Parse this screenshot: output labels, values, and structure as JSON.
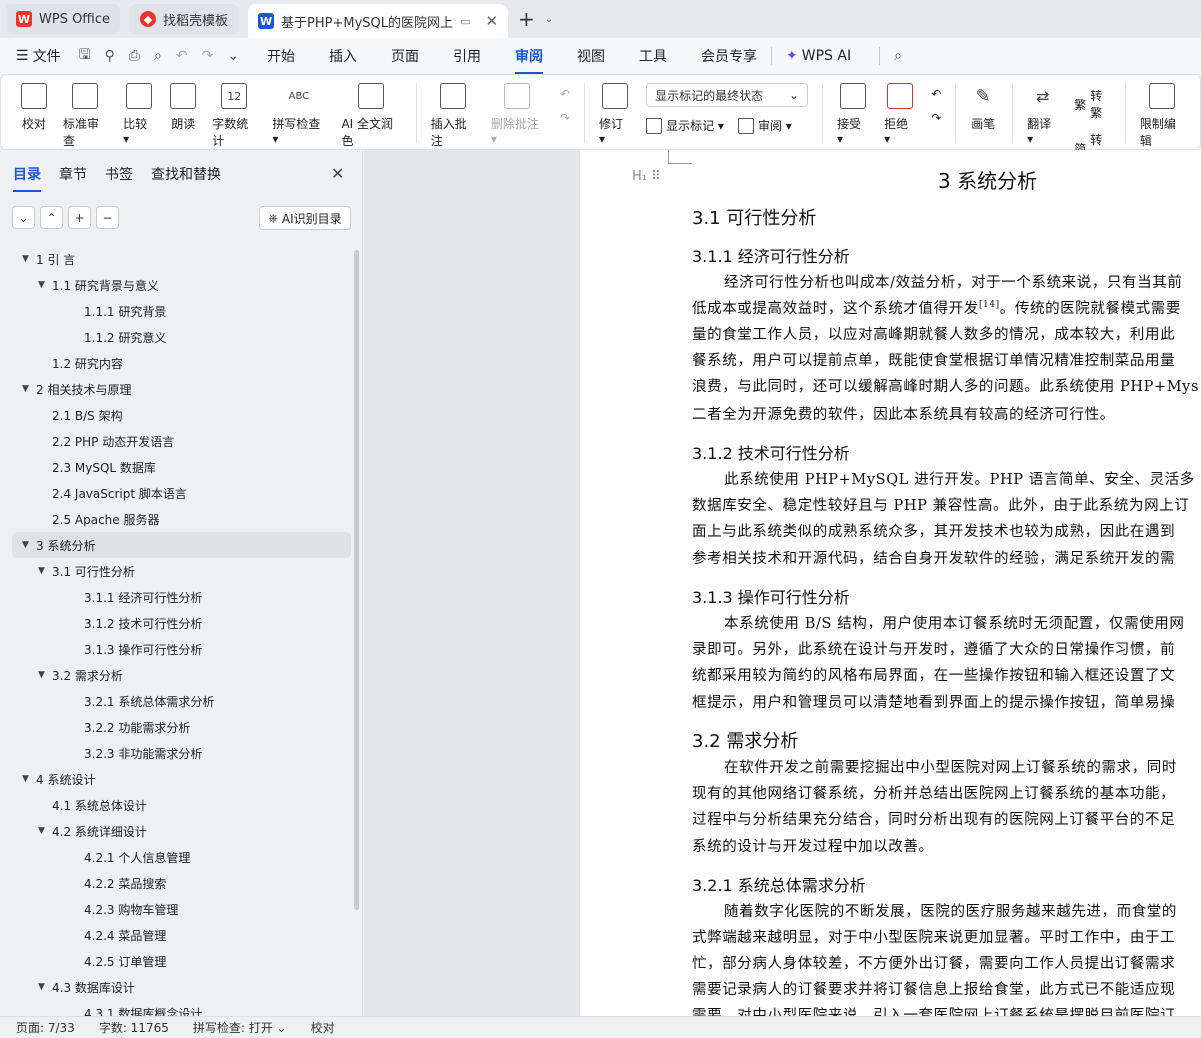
{
  "tabs": [
    {
      "label": "WPS Office",
      "icon": "wps-logo",
      "color": "#e8352e"
    },
    {
      "label": "找稻壳模板",
      "icon": "docer-logo",
      "color": "#e8352e"
    },
    {
      "label": "基于PHP+MySQL的医院网上",
      "icon": "word-doc-logo",
      "color": "#1a56db"
    }
  ],
  "menubar": {
    "file": "文件",
    "tabs": [
      "开始",
      "插入",
      "页面",
      "引用",
      "审阅",
      "视图",
      "工具",
      "会员专享"
    ],
    "active": "审阅",
    "ai": "WPS AI"
  },
  "ribbon": {
    "group1": [
      {
        "label": "校对",
        "icon": "proofread-icon"
      },
      {
        "label": "标准审查",
        "icon": "standard-review-icon"
      },
      {
        "label": "比较 ▾",
        "icon": "compare-icon"
      },
      {
        "label": "朗读",
        "icon": "read-aloud-icon"
      },
      {
        "label": "字数统计",
        "icon": "word-count-icon",
        "glyph": "12"
      },
      {
        "label": "拼写检查 ▾",
        "icon": "spell-check-icon",
        "glyph": "ABC"
      },
      {
        "label": "AI 全文润色",
        "icon": "ai-polish-icon"
      }
    ],
    "insert_comment": "插入批注",
    "delete_comment": "删除批注 ▾",
    "revise": "修订 ▾",
    "markup_dropdown": "显示标记的最终状态",
    "show_markup": "显示标记 ▾",
    "review": "审阅 ▾",
    "accept": "接受 ▾",
    "reject": "拒绝 ▾",
    "brush": "画笔",
    "translate": "翻译 ▾",
    "to_trad": "转繁",
    "to_simp": "转简",
    "restrict": "限制编辑"
  },
  "nav": {
    "tabs": [
      "目录",
      "章节",
      "书签",
      "查找和替换"
    ],
    "active": "目录",
    "ai_btn": "AI识别目录",
    "toc": [
      {
        "label": "1  引  言",
        "level": 1,
        "arrow": "▼"
      },
      {
        "label": "1.1  研究背景与意义",
        "level": 2,
        "arrow": "▼"
      },
      {
        "label": "1.1.1  研究背景",
        "level": 3,
        "arrow": ""
      },
      {
        "label": "1.1.2  研究意义",
        "level": 3,
        "arrow": ""
      },
      {
        "label": "1.2  研究内容",
        "level": 2,
        "arrow": ""
      },
      {
        "label": "2  相关技术与原理",
        "level": 1,
        "arrow": "▼"
      },
      {
        "label": "2.1 B/S 架构",
        "level": 2,
        "arrow": ""
      },
      {
        "label": "2.2 PHP 动态开发语言",
        "level": 2,
        "arrow": ""
      },
      {
        "label": "2.3 MySQL 数据库",
        "level": 2,
        "arrow": ""
      },
      {
        "label": "2.4 JavaScript 脚本语言",
        "level": 2,
        "arrow": ""
      },
      {
        "label": "2.5 Apache 服务器",
        "level": 2,
        "arrow": ""
      },
      {
        "label": "3  系统分析",
        "level": 1,
        "arrow": "▼",
        "selected": true
      },
      {
        "label": "3.1  可行性分析",
        "level": 2,
        "arrow": "▼"
      },
      {
        "label": "3.1.1  经济可行性分析",
        "level": 3,
        "arrow": ""
      },
      {
        "label": "3.1.2  技术可行性分析",
        "level": 3,
        "arrow": ""
      },
      {
        "label": "3.1.3  操作可行性分析",
        "level": 3,
        "arrow": ""
      },
      {
        "label": "3.2  需求分析",
        "level": 2,
        "arrow": "▼"
      },
      {
        "label": "3.2.1  系统总体需求分析",
        "level": 3,
        "arrow": ""
      },
      {
        "label": "3.2.2  功能需求分析",
        "level": 3,
        "arrow": ""
      },
      {
        "label": "3.2.3  非功能需求分析",
        "level": 3,
        "arrow": ""
      },
      {
        "label": "4  系统设计",
        "level": 1,
        "arrow": "▼"
      },
      {
        "label": "4.1  系统总体设计",
        "level": 2,
        "arrow": ""
      },
      {
        "label": "4.2  系统详细设计",
        "level": 2,
        "arrow": "▼"
      },
      {
        "label": "4.2.1  个人信息管理",
        "level": 3,
        "arrow": ""
      },
      {
        "label": "4.2.2  菜品搜索",
        "level": 3,
        "arrow": ""
      },
      {
        "label": "4.2.3  购物车管理",
        "level": 3,
        "arrow": ""
      },
      {
        "label": "4.2.4  菜品管理",
        "level": 3,
        "arrow": ""
      },
      {
        "label": "4.2.5  订单管理",
        "level": 3,
        "arrow": ""
      },
      {
        "label": "4.3  数据库设计",
        "level": 2,
        "arrow": "▼"
      },
      {
        "label": "4.3.1  数据库概念设计",
        "level": 3,
        "arrow": ""
      }
    ]
  },
  "doc": {
    "h1": "3  系统分析",
    "s31": "3.1  可行性分析",
    "s311": "3.1.1  经济可行性分析",
    "p311": [
      "经济可行性分析也叫成本/效益分析，对于一个系统来说，只有当其前",
      "低成本或提高效益时，这个系统才值得开发",
      "量的食堂工作人员，以应对高峰期就餐人数多的情况，成本较大，利用此",
      "餐系统，用户可以提前点单，既能使食堂根据订单情况精准控制菜品用量",
      "浪费，与此同时，还可以缓解高峰时期人多的问题。此系统使用 PHP+Mys",
      "二者全为开源免费的软件，因此本系统具有较高的经济可行性。"
    ],
    "ref14": "[14]",
    "p311_tail": "。传统的医院就餐模式需要",
    "s312": "3.1.2  技术可行性分析",
    "p312": [
      "此系统使用 PHP+MySQL 进行开发。PHP 语言简单、安全、灵活多",
      "数据库安全、稳定性较好且与 PHP 兼容性高。此外，由于此系统为网上订",
      "面上与此系统类似的成熟系统众多，其开发技术也较为成熟，因此在遇到",
      "参考相关技术和开源代码，结合自身开发软件的经验，满足系统开发的需"
    ],
    "s313": "3.1.3  操作可行性分析",
    "p313": [
      "本系统使用 B/S 结构，用户使用本订餐系统时无须配置，仅需使用网",
      "录即可。另外，此系统在设计与开发时，遵循了大众的日常操作习惯，前",
      "统都采用较为简约的风格布局界面，在一些操作按钮和输入框还设置了文",
      "框提示，用户和管理员可以清楚地看到界面上的提示操作按钮，简单易操"
    ],
    "s32": "3.2  需求分析",
    "p32": [
      "在软件开发之前需要挖掘出中小型医院对网上订餐系统的需求，同时",
      "现有的其他网络订餐系统，分析并总结出医院网上订餐系统的基本功能，",
      "过程中与分析结果充分结合，同时分析出现有的医院网上订餐平台的不足",
      "系统的设计与开发过程中加以改善。"
    ],
    "s321": "3.2.1  系统总体需求分析",
    "p321": [
      "随着数字化医院的不断发展，医院的医疗服务越来越先进，而食堂的",
      "式弊端越来越明显，对于中小型医院来说更加显著。平时工作中，由于工",
      "忙，部分病人身体较差，不方便外出订餐，需要向工作人员提出订餐需求",
      "需要记录病人的订餐要求并将订餐信息上报给食堂，此方式已不能适应现",
      "需要。对中小型医院来说，引入一套医院网上订餐系统是摆脱目前医院订"
    ]
  },
  "status": {
    "page": "页面: 7/33",
    "words": "字数: 11765",
    "spell": "拼写检查: 打开 ⌄",
    "proof": "校对"
  }
}
